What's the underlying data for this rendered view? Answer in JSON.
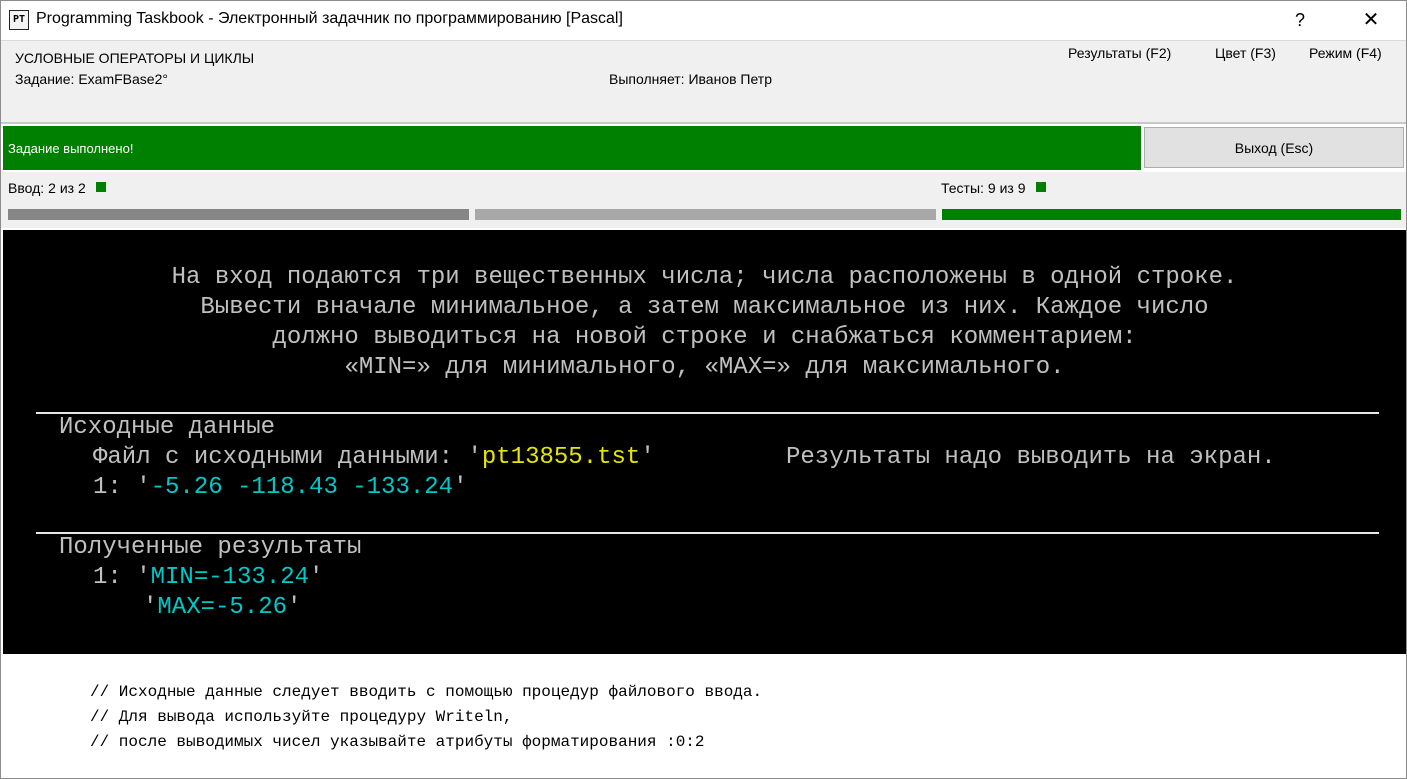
{
  "window": {
    "icon_text": "PT",
    "title": "Programming Taskbook - Электронный задачник по программированию [Pascal]",
    "help_label": "?",
    "close_label": "✕"
  },
  "header": {
    "group": "УСЛОВНЫЕ ОПЕРАТОРЫ И ЦИКЛЫ",
    "task": "Задание: ExamFBase2°",
    "student": "Выполняет: Иванов Петр",
    "menu": {
      "results": "Результаты (F2)",
      "color": "Цвет (F3)",
      "mode": "Режим (F4)"
    }
  },
  "status": {
    "message": "Задание выполнено!",
    "exit_label": "Выход (Esc)",
    "color": "#008000"
  },
  "progress": {
    "input_label": "Ввод:",
    "input_value": "2 из 2",
    "tests_label": "Тесты:",
    "tests_value": "9 из 9"
  },
  "task_text": [
    "На вход подаются три вещественных числа; числа расположены в одной строке.",
    "Вывести вначале минимальное, а затем максимальное из них. Каждое число",
    "должно выводиться на новой строке и снабжаться комментарием:",
    "«MIN=» для минимального, «MAX=» для максимального."
  ],
  "source": {
    "heading": "Исходные данные",
    "file_prefix": "Файл с исходными данными: '",
    "file_name": "pt13855.tst",
    "file_suffix": "'",
    "screen_note": "Результаты надо выводить на экран.",
    "line_num": "1: '",
    "line_value": "-5.26 -118.43 -133.24",
    "line_end": "'"
  },
  "results": {
    "heading": "Полученные результаты",
    "line1_num": "1: '",
    "line1_value": "MIN=-133.24",
    "line1_end": "'",
    "line2_start": "'",
    "line2_value": "MAX=-5.26",
    "line2_end": "'"
  },
  "comments": [
    "// Исходные данные следует вводить с помощью процедур файлового ввода.",
    "// Для вывода используйте процедуру Writeln,",
    "// после выводимых чисел указывайте атрибуты форматирования :0:2"
  ]
}
